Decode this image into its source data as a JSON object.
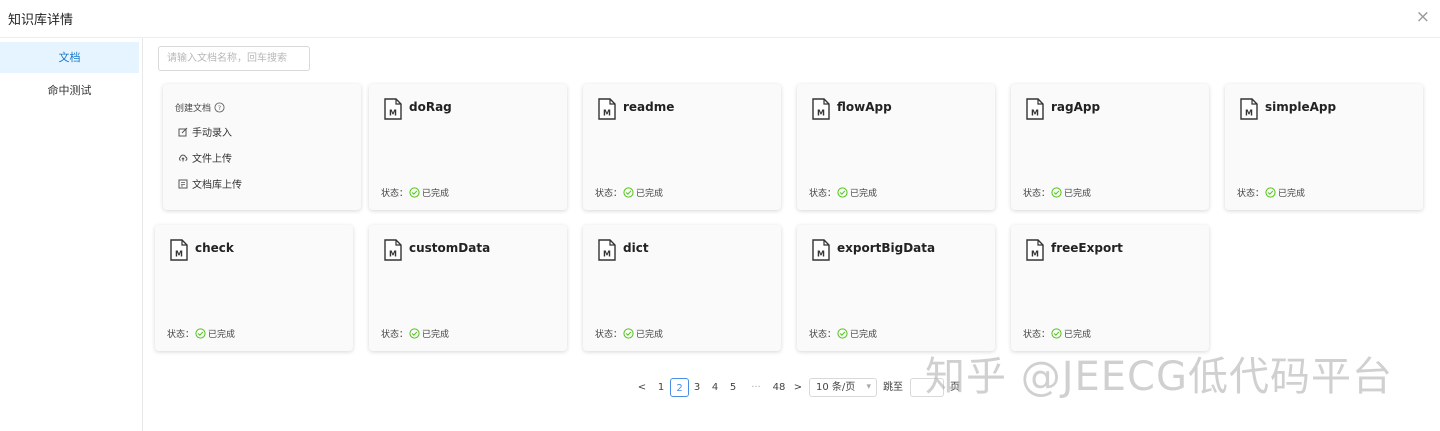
{
  "header": {
    "title": "知识库详情",
    "close_label": "×"
  },
  "sidebar": {
    "items": [
      {
        "label": "文档"
      },
      {
        "label": "命中测试"
      }
    ]
  },
  "search": {
    "placeholder": "请输入文档名称，回车搜索"
  },
  "create": {
    "title": "创建文档",
    "options": [
      {
        "label": "手动录入"
      },
      {
        "label": "文件上传"
      },
      {
        "label": "文档库上传"
      }
    ]
  },
  "documents": [
    {
      "name": "doRag",
      "status_label": "状态：",
      "status": "已完成"
    },
    {
      "name": "readme",
      "status_label": "状态：",
      "status": "已完成"
    },
    {
      "name": "flowApp",
      "status_label": "状态：",
      "status": "已完成"
    },
    {
      "name": "ragApp",
      "status_label": "状态：",
      "status": "已完成"
    },
    {
      "name": "simpleApp",
      "status_label": "状态：",
      "status": "已完成"
    },
    {
      "name": "check",
      "status_label": "状态：",
      "status": "已完成"
    },
    {
      "name": "customData",
      "status_label": "状态：",
      "status": "已完成"
    },
    {
      "name": "dict",
      "status_label": "状态：",
      "status": "已完成"
    },
    {
      "name": "exportBigData",
      "status_label": "状态：",
      "status": "已完成"
    },
    {
      "name": "freeExport",
      "status_label": "状态：",
      "status": "已完成"
    }
  ],
  "pagination": {
    "prev": "<",
    "next": ">",
    "pages": [
      "1",
      "2",
      "3",
      "4",
      "5"
    ],
    "current": "2",
    "ellipsis": "···",
    "last": "48",
    "page_size": "10 条/页",
    "jump_label": "跳至",
    "page_unit": "页"
  },
  "watermark": "知乎 @JEECG低代码平台",
  "colors": {
    "accent": "#1677c8",
    "success": "#52c41a",
    "active_bg": "#e6f4ff"
  }
}
